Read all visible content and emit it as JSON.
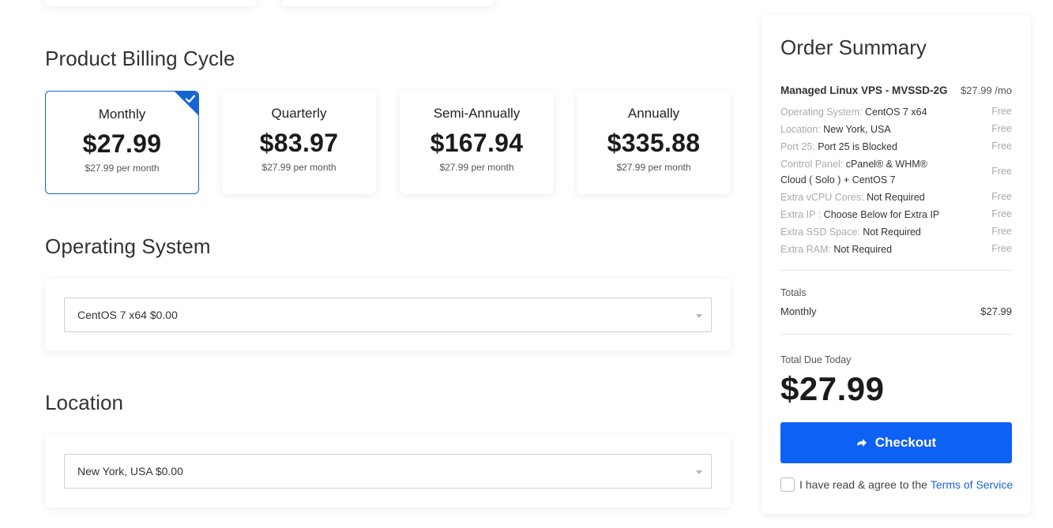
{
  "billing": {
    "title": "Product Billing Cycle",
    "cycles": [
      {
        "name": "Monthly",
        "price": "$27.99",
        "sub": "$27.99 per month",
        "selected": true
      },
      {
        "name": "Quarterly",
        "price": "$83.97",
        "sub": "$27.99 per month",
        "selected": false
      },
      {
        "name": "Semi-Annually",
        "price": "$167.94",
        "sub": "$27.99 per month",
        "selected": false
      },
      {
        "name": "Annually",
        "price": "$335.88",
        "sub": "$27.99 per month",
        "selected": false
      }
    ]
  },
  "os": {
    "title": "Operating System",
    "selected": "CentOS 7 x64 $0.00"
  },
  "location": {
    "title": "Location",
    "selected": "New York, USA $0.00"
  },
  "summary": {
    "title": "Order Summary",
    "product": "Managed Linux VPS - MVSSD-2G",
    "product_price": "$27.99 /mo",
    "options": [
      {
        "label": "Operating System:",
        "value": "CentOS 7 x64",
        "price": "Free"
      },
      {
        "label": "Location:",
        "value": "New York, USA",
        "price": "Free"
      },
      {
        "label": "Port 25:",
        "value": "Port 25 is Blocked",
        "price": "Free"
      },
      {
        "label": "Control Panel:",
        "value": "cPanel® & WHM® Cloud ( Solo ) + CentOS 7",
        "price": "Free"
      },
      {
        "label": "Extra vCPU Cores:",
        "value": "Not Required",
        "price": "Free"
      },
      {
        "label": "Extra IP :",
        "value": "Choose Below for Extra IP",
        "price": "Free"
      },
      {
        "label": "Extra SSD Space:",
        "value": "Not Required",
        "price": "Free"
      },
      {
        "label": "Extra RAM:",
        "value": "Not Required",
        "price": "Free"
      }
    ],
    "totals_label": "Totals",
    "totals_row": {
      "label": "Monthly",
      "value": "$27.99"
    },
    "due_label": "Total Due Today",
    "due_amount": "$27.99",
    "checkout_label": "Checkout",
    "tos_text": "I have read & agree to the",
    "tos_link": "Terms of Service"
  },
  "colors": {
    "accent": "#1764d6",
    "button": "#0e61f5"
  },
  "icons": {
    "selected_check": "check-icon",
    "checkout": "arrow-right-icon",
    "select_caret": "caret-down-icon"
  }
}
